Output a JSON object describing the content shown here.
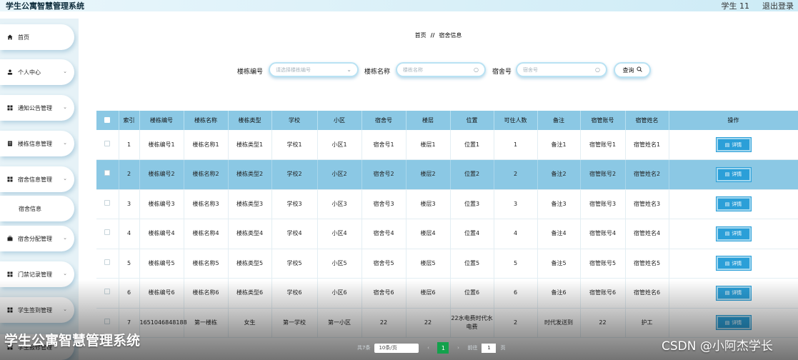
{
  "header": {
    "title": "学生公寓智慧管理系统",
    "user": "学生 11",
    "logout": "退出登录"
  },
  "sidebar": {
    "items": [
      {
        "label": "首页",
        "icon": "home-icon"
      },
      {
        "label": "个人中心",
        "icon": "user-icon"
      },
      {
        "label": "通知公告管理",
        "icon": "grid-icon"
      },
      {
        "label": "楼栋信息管理",
        "icon": "building-icon"
      },
      {
        "label": "宿舍信息管理",
        "icon": "grid-icon"
      },
      {
        "label": "宿舍信息",
        "icon": ""
      },
      {
        "label": "宿舍分配管理",
        "icon": "briefcase-icon"
      },
      {
        "label": "门禁记录管理",
        "icon": "grid-icon"
      },
      {
        "label": "学生签到管理",
        "icon": "grid-icon"
      },
      {
        "label": "学生报修管理",
        "icon": "grid-icon"
      }
    ]
  },
  "breadcrumb": {
    "home": "首页",
    "separator": "//",
    "current": "宿舍信息"
  },
  "filters": {
    "building_no_label": "楼栋编号",
    "building_no_placeholder": "请选择楼栋编号",
    "building_name_label": "楼栋名称",
    "building_name_placeholder": "楼栋名称",
    "room_no_label": "宿舍号",
    "room_no_placeholder": "宿舍号",
    "query_label": "查询"
  },
  "table": {
    "columns": [
      "索引",
      "楼栋编号",
      "楼栋名称",
      "楼栋类型",
      "学校",
      "小区",
      "宿舍号",
      "楼层",
      "位置",
      "可住人数",
      "备注",
      "宿管账号",
      "宿管姓名",
      "操作"
    ],
    "detail_label": "详情",
    "rows": [
      [
        "1",
        "楼栋编号1",
        "楼栋名称1",
        "楼栋类型1",
        "学校1",
        "小区1",
        "宿舍号1",
        "楼层1",
        "位置1",
        "1",
        "备注1",
        "宿管账号1",
        "宿管姓名1"
      ],
      [
        "2",
        "楼栋编号2",
        "楼栋名称2",
        "楼栋类型2",
        "学校2",
        "小区2",
        "宿舍号2",
        "楼层2",
        "位置2",
        "2",
        "备注2",
        "宿管账号2",
        "宿管姓名2"
      ],
      [
        "3",
        "楼栋编号3",
        "楼栋名称3",
        "楼栋类型3",
        "学校3",
        "小区3",
        "宿舍号3",
        "楼层3",
        "位置3",
        "3",
        "备注3",
        "宿管账号3",
        "宿管姓名3"
      ],
      [
        "4",
        "楼栋编号4",
        "楼栋名称4",
        "楼栋类型4",
        "学校4",
        "小区4",
        "宿舍号4",
        "楼层4",
        "位置4",
        "4",
        "备注4",
        "宿管账号4",
        "宿管姓名4"
      ],
      [
        "5",
        "楼栋编号5",
        "楼栋名称5",
        "楼栋类型5",
        "学校5",
        "小区5",
        "宿舍号5",
        "楼层5",
        "位置5",
        "5",
        "备注5",
        "宿管账号5",
        "宿管姓名5"
      ],
      [
        "6",
        "楼栋编号6",
        "楼栋名称6",
        "楼栋类型6",
        "学校6",
        "小区6",
        "宿舍号6",
        "楼层6",
        "位置6",
        "6",
        "备注6",
        "宿管账号6",
        "宿管姓名6"
      ],
      [
        "7",
        "1651046848188",
        "第一楼栋",
        "女生",
        "第一学校",
        "第一小区",
        "22",
        "22",
        "22水电费时代水电费",
        "2",
        "时代发送到",
        "22",
        "护工"
      ]
    ]
  },
  "pager": {
    "total": "共7条",
    "page_size": "10条/页",
    "current_page": "1",
    "goto_label": "前往",
    "goto_value": "1",
    "page_unit": "页"
  },
  "watermark": {
    "left": "学生公寓智慧管理系统",
    "right": "CSDN @小阿杰学长"
  },
  "colors": {
    "header_bg": "#8bc8e4",
    "selected_row": "#8bc8e4",
    "detail_button": "#2b9fd8",
    "current_page": "#13a14c"
  }
}
